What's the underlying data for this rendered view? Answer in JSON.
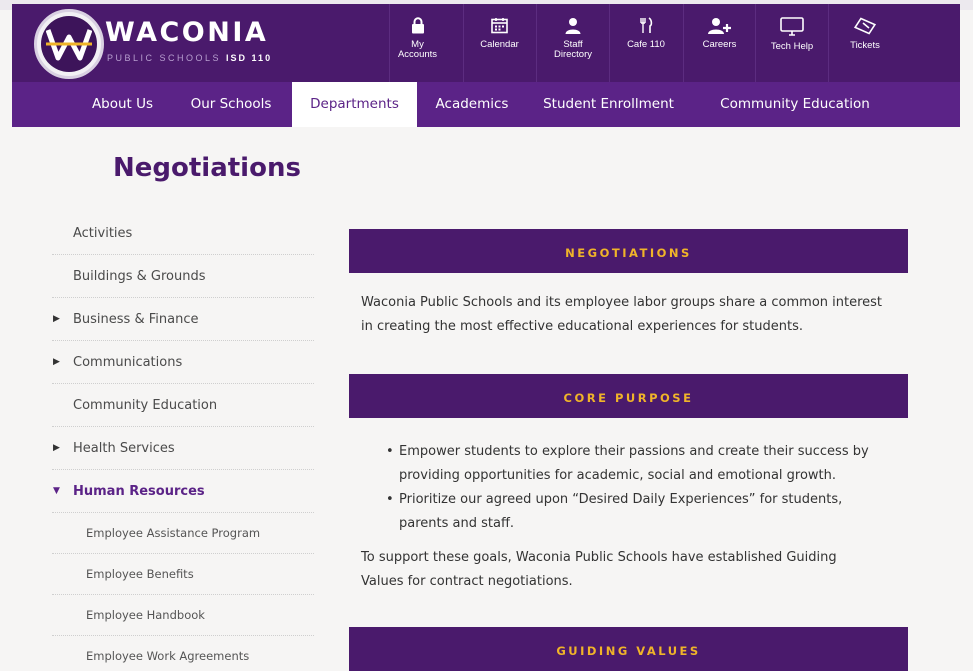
{
  "brand": {
    "name": "WACONIA",
    "subtitle": "PUBLIC SCHOOLS",
    "district": "ISD 110"
  },
  "utility_nav": [
    {
      "label": "My Accounts",
      "icon": "lock-icon"
    },
    {
      "label": "Calendar",
      "icon": "calendar-icon"
    },
    {
      "label": "Staff Directory",
      "icon": "person-icon"
    },
    {
      "label": "Cafe 110",
      "icon": "fork-knife-icon"
    },
    {
      "label": "Careers",
      "icon": "add-user-icon"
    },
    {
      "label": "Tech Help",
      "icon": "monitor-icon"
    },
    {
      "label": "Tickets",
      "icon": "ticket-icon"
    }
  ],
  "main_nav": [
    {
      "label": "About Us"
    },
    {
      "label": "Our Schools"
    },
    {
      "label": "Departments",
      "active": true
    },
    {
      "label": "Academics"
    },
    {
      "label": "Student Enrollment"
    },
    {
      "label": "Community Education"
    }
  ],
  "page_title": "Negotiations",
  "sidebar": {
    "items": [
      {
        "label": "Activities",
        "has_arrow": false
      },
      {
        "label": "Buildings & Grounds",
        "has_arrow": false
      },
      {
        "label": "Business & Finance",
        "has_arrow": true
      },
      {
        "label": "Communications",
        "has_arrow": true
      },
      {
        "label": "Community Education",
        "has_arrow": false
      },
      {
        "label": "Health Services",
        "has_arrow": true
      },
      {
        "label": "Human Resources",
        "has_arrow": true,
        "expanded": true
      }
    ],
    "sub_items": [
      {
        "label": "Employee Assistance Program"
      },
      {
        "label": "Employee Benefits"
      },
      {
        "label": "Employee Handbook"
      },
      {
        "label": "Employee Work Agreements"
      }
    ]
  },
  "content": {
    "banner_negotiations": "NEGOTIATIONS",
    "intro_line1": "Waconia Public Schools and its employee labor groups share a common interest",
    "intro_line2": "in creating the most effective educational experiences for students.",
    "banner_core": "CORE PURPOSE",
    "bullet1_line1": "Empower students to explore their passions and create their success by",
    "bullet1_line2": "providing opportunities for academic, social and emotional growth.",
    "bullet2_line1": "Prioritize our agreed upon “Desired Daily Experiences” for students,",
    "bullet2_line2": "parents and staff.",
    "support_line1": "To support these goals, Waconia Public Schools have established Guiding",
    "support_line2": "Values for contract negotiations.",
    "banner_guiding": "GUIDING VALUES"
  },
  "colors": {
    "primary_purple": "#4a1a6c",
    "nav_purple": "#5b2387",
    "banner_gold": "#f0b429"
  }
}
